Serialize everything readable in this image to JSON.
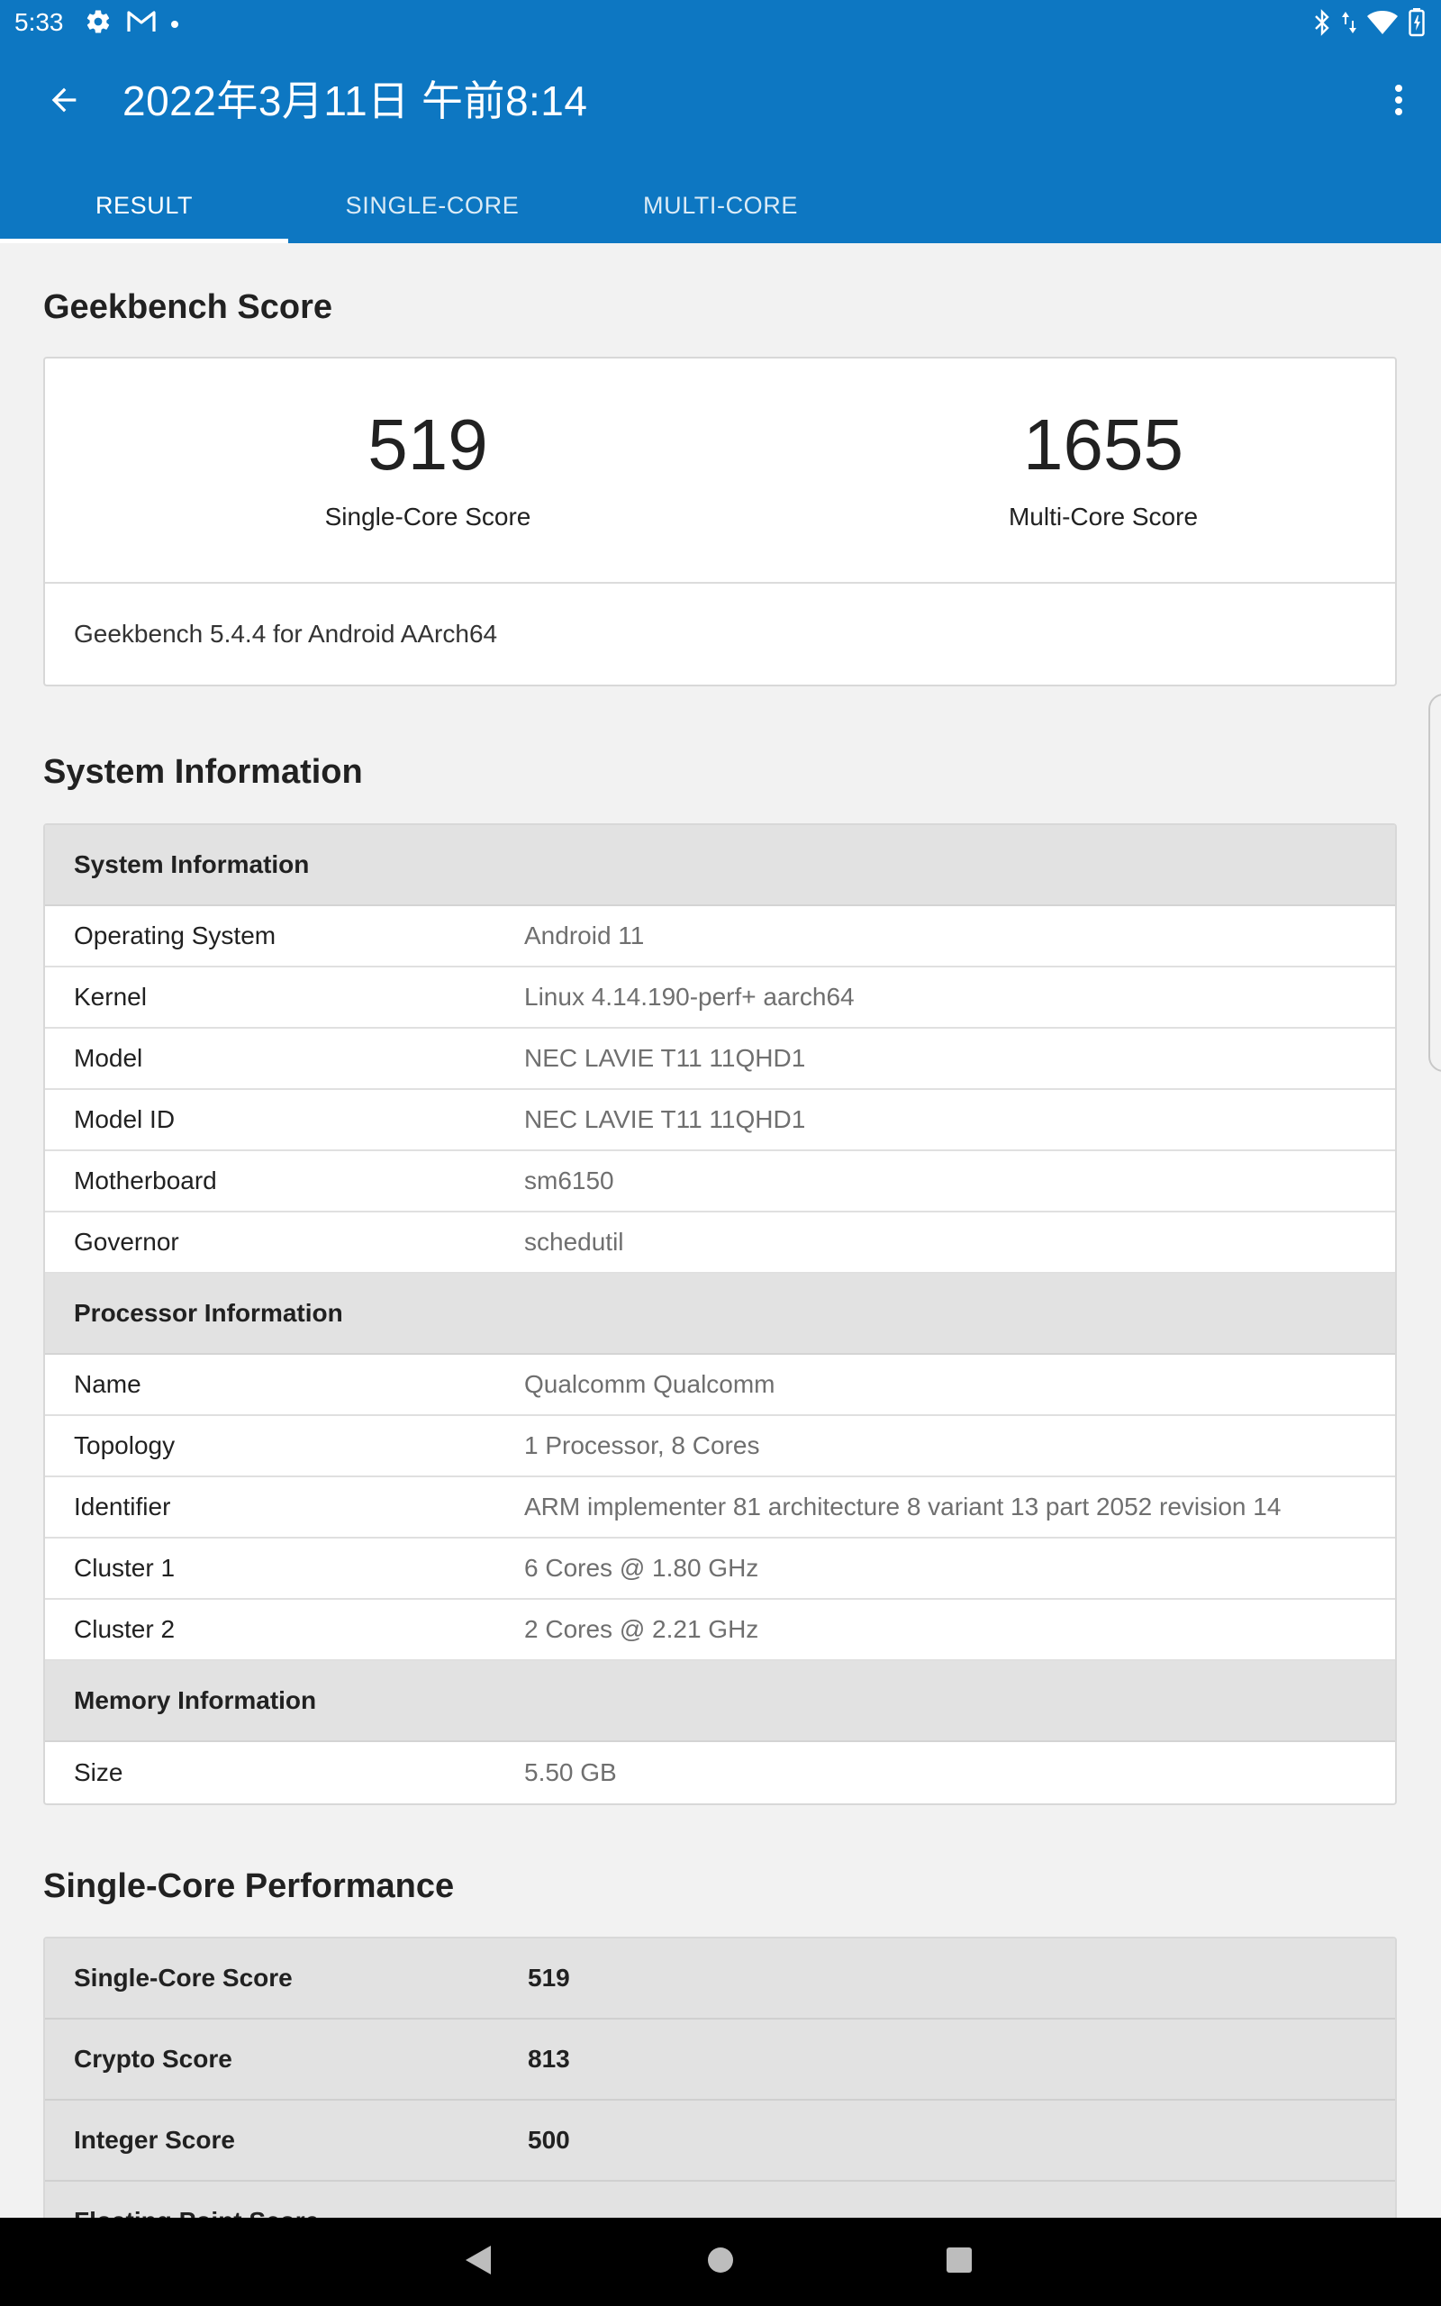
{
  "status_bar": {
    "time": "5:33",
    "left_icons": [
      "gear-icon",
      "gmail-icon",
      "notification-dot-icon"
    ],
    "right_icons": [
      "bluetooth-icon",
      "data-arrows-icon",
      "wifi-icon",
      "battery-icon"
    ]
  },
  "toolbar": {
    "title": "2022年3月11日 午前8:14",
    "back_icon": "arrow-back-icon",
    "more_icon": "more-vert-icon"
  },
  "tabs": [
    {
      "label": "RESULT",
      "active": true
    },
    {
      "label": "SINGLE-CORE",
      "active": false
    },
    {
      "label": "MULTI-CORE",
      "active": false
    }
  ],
  "geekbench": {
    "title": "Geekbench Score",
    "single_value": "519",
    "single_label": "Single-Core Score",
    "multi_value": "1655",
    "multi_label": "Multi-Core Score",
    "version": "Geekbench 5.4.4 for Android AArch64"
  },
  "system_info": {
    "title": "System Information",
    "sections": [
      {
        "header": "System Information",
        "rows": [
          {
            "key": "Operating System",
            "value": "Android 11"
          },
          {
            "key": "Kernel",
            "value": "Linux 4.14.190-perf+ aarch64"
          },
          {
            "key": "Model",
            "value": "NEC LAVIE T11 11QHD1"
          },
          {
            "key": "Model ID",
            "value": "NEC LAVIE T11 11QHD1"
          },
          {
            "key": "Motherboard",
            "value": "sm6150"
          },
          {
            "key": "Governor",
            "value": "schedutil"
          }
        ]
      },
      {
        "header": "Processor Information",
        "rows": [
          {
            "key": "Name",
            "value": "Qualcomm Qualcomm"
          },
          {
            "key": "Topology",
            "value": "1 Processor, 8 Cores"
          },
          {
            "key": "Identifier",
            "value": "ARM implementer 81 architecture 8 variant 13 part 2052 revision 14"
          },
          {
            "key": "Cluster 1",
            "value": "6 Cores @ 1.80 GHz"
          },
          {
            "key": "Cluster 2",
            "value": "2 Cores @ 2.21 GHz"
          }
        ]
      },
      {
        "header": "Memory Information",
        "rows": [
          {
            "key": "Size",
            "value": "5.50 GB"
          }
        ]
      }
    ]
  },
  "single_core": {
    "title": "Single-Core Performance",
    "rows": [
      {
        "key": "Single-Core Score",
        "value": "519"
      },
      {
        "key": "Crypto Score",
        "value": "813"
      },
      {
        "key": "Integer Score",
        "value": "500"
      },
      {
        "key": "Floating Point Score",
        "value": ""
      }
    ]
  },
  "nav_bar": {
    "icons": [
      "nav-back-icon",
      "nav-home-icon",
      "nav-recents-icon"
    ]
  },
  "colors": {
    "app_bar": "#0d77c2",
    "background": "#f2f2f2",
    "table_header": "#e2e2e2"
  }
}
